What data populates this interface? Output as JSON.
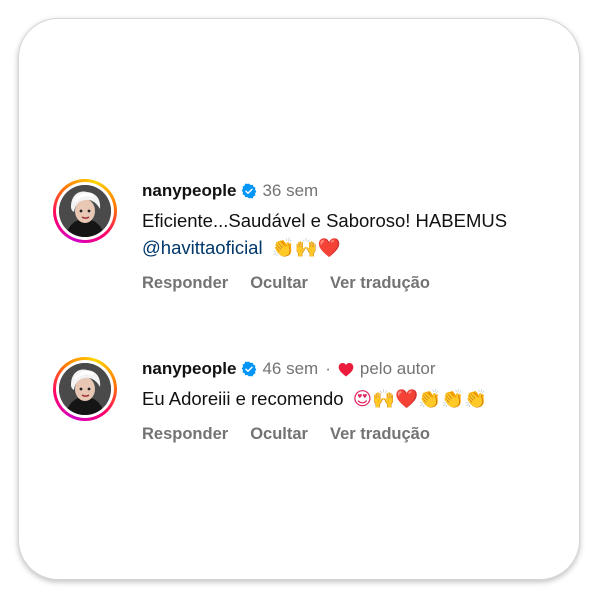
{
  "comments": [
    {
      "username": "nanypeople",
      "time": "36 sem",
      "text": "Eficiente...Saudável e Saboroso! HABEMUS",
      "mention": "@havittaoficial",
      "emojis": "👏🙌❤️",
      "actions": {
        "reply": "Responder",
        "hide": "Ocultar",
        "translate": "Ver tradução"
      }
    },
    {
      "username": "nanypeople",
      "time": "46 sem",
      "separator": "·",
      "liked_by_author": "pelo autor",
      "text": "Eu Adoreiii e recomendo",
      "emojis": "😍🙌❤️👏👏👏",
      "actions": {
        "reply": "Responder",
        "hide": "Ocultar",
        "translate": "Ver tradução"
      }
    }
  ],
  "icons": {
    "verified": "verified-badge-icon",
    "heart": "heart-icon"
  },
  "colors": {
    "verified_blue": "#0095f6",
    "heart_red": "#ed1b3b",
    "secondary_text": "#737373",
    "mention": "#00376b"
  }
}
